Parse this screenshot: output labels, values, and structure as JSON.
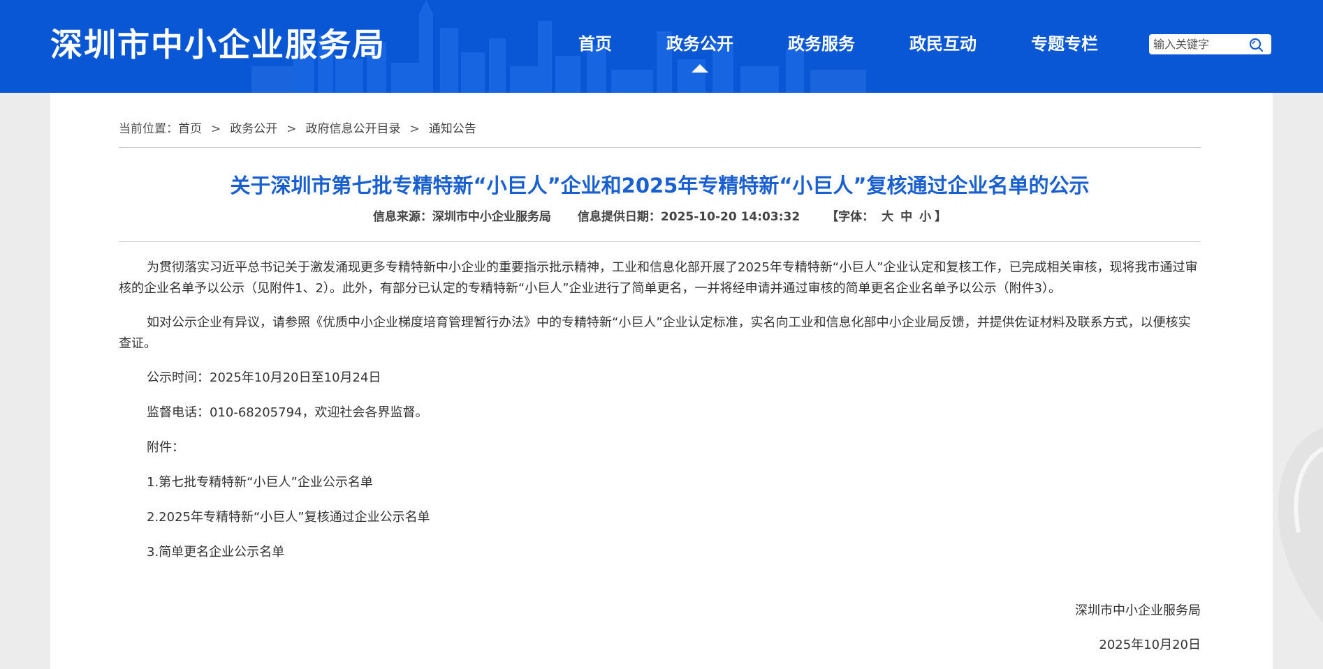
{
  "header": {
    "site_title": "深圳市中小企业服务局",
    "nav": [
      {
        "label": "首页",
        "active": false
      },
      {
        "label": "政务公开",
        "active": true
      },
      {
        "label": "政务服务",
        "active": false
      },
      {
        "label": "政民互动",
        "active": false
      },
      {
        "label": "专题专栏",
        "active": false
      }
    ],
    "search": {
      "placeholder": "输入关键字",
      "icon": "search-icon"
    }
  },
  "breadcrumb": {
    "prefix": "当前位置：",
    "items": [
      "首页",
      "政务公开",
      "政府信息公开目录",
      "通知公告"
    ],
    "separator": ">"
  },
  "article": {
    "title": "关于深圳市第七批专精特新“小巨人”企业和2025年专精特新“小巨人”复核通过企业名单的公示",
    "source_label": "信息来源：",
    "source": "深圳市中小企业服务局",
    "date_label": "信息提供日期：",
    "date": "2025-10-20 14:03:32",
    "font_size_label_open": "【字体：",
    "font_sizes": [
      "大",
      "中",
      "小"
    ],
    "font_size_label_close": "】",
    "paragraphs": [
      "为贯彻落实习近平总书记关于激发涌现更多专精特新中小企业的重要指示批示精神，工业和信息化部开展了2025年专精特新“小巨人”企业认定和复核工作，已完成相关审核，现将我市通过审核的企业名单予以公示（见附件1、2）。此外，有部分已认定的专精特新“小巨人”企业进行了简单更名，一并将经申请并通过审核的简单更名企业名单予以公示（附件3）。",
      "如对公示企业有异议，请参照《优质中小企业梯度培育管理暂行办法》中的专精特新“小巨人”企业认定标准，实名向工业和信息化部中小企业局反馈，并提供佐证材料及联系方式，以便核实查证。",
      "公示时间：2025年10月20日至10月24日",
      "监督电话：010-68205794，欢迎社会各界监督。",
      "附件：",
      "1.第七批专精特新“小巨人”企业公示名单",
      "2.2025年专精特新“小巨人”复核通过企业公示名单",
      "3.简单更名企业公示名单"
    ],
    "signature_org": "深圳市中小企业服务局",
    "signature_date": "2025年10月20日"
  },
  "colors": {
    "header_bg": "#0a57d6",
    "title_blue": "#1a5fd0",
    "page_bg": "#ececec"
  }
}
